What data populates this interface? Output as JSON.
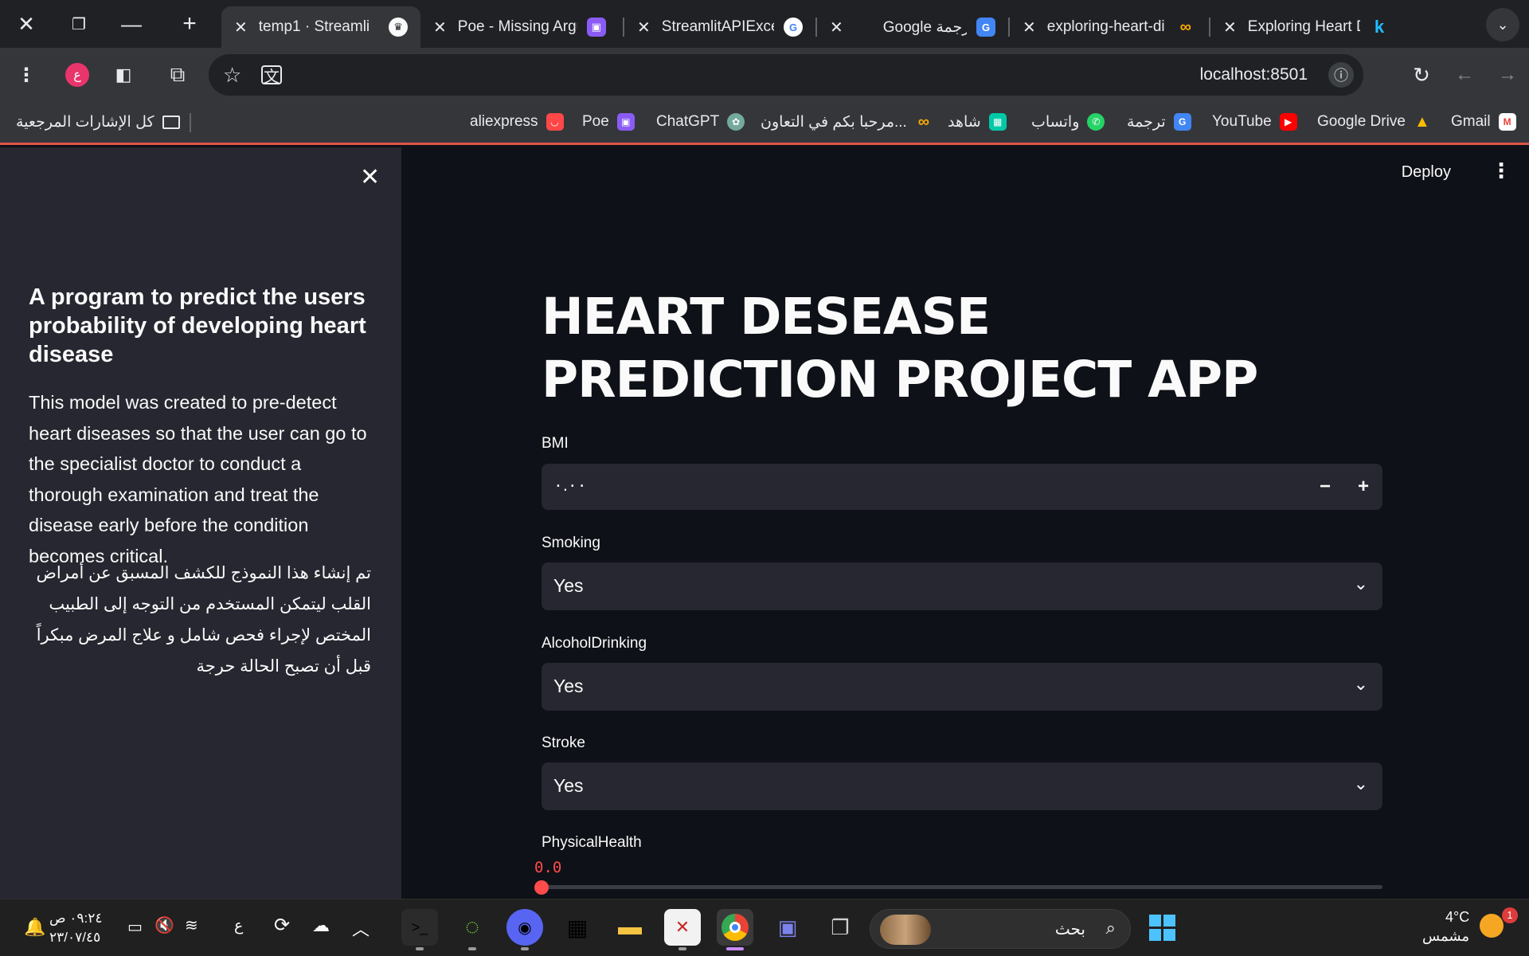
{
  "browser": {
    "tabs": [
      {
        "title": "temp1 · Streamlit",
        "active": true,
        "favicon": "streamlit-crown-icon"
      },
      {
        "title": "Poe - Missing Argu",
        "active": false,
        "favicon": "poe-icon"
      },
      {
        "title": "StreamlitAPIExcept",
        "active": false,
        "favicon": "google-icon"
      },
      {
        "title": "Google ترجمة",
        "active": false,
        "favicon": "google-translate-icon"
      },
      {
        "title": "exploring-heart-di",
        "active": false,
        "favicon": "colab-icon"
      },
      {
        "title": "Exploring Heart Dis",
        "active": false,
        "favicon": "kaggle-icon"
      }
    ],
    "profile_initial": "ع",
    "url": "localhost:8501",
    "bookmarks": [
      {
        "label": "Gmail",
        "icon": "gmail-icon",
        "color": "#ea4335"
      },
      {
        "label": "Google Drive",
        "icon": "google-drive-icon",
        "color": "#1fa463"
      },
      {
        "label": "YouTube",
        "icon": "youtube-icon",
        "color": "#ff0000"
      },
      {
        "label": "ترجمة",
        "icon": "google-translate-icon",
        "color": "#4285f4"
      },
      {
        "label": "واتساب",
        "icon": "whatsapp-icon",
        "color": "#25d366"
      },
      {
        "label": "شاهد",
        "icon": "shahid-icon",
        "color": "#00c9a7"
      },
      {
        "label": "مرحبا بكم في التعاون...",
        "icon": "colab-icon",
        "color": "#f9ab00"
      },
      {
        "label": "ChatGPT",
        "icon": "chatgpt-icon",
        "color": "#74aa9c"
      },
      {
        "label": "Poe",
        "icon": "poe-icon",
        "color": "#8a5cf5"
      },
      {
        "label": "aliexpress",
        "icon": "aliexpress-icon",
        "color": "#ff4747"
      }
    ],
    "all_bookmarks_label": "كل الإشارات المرجعية"
  },
  "app": {
    "deploy_label": "Deploy",
    "sidebar": {
      "title": "A program to predict the users probability of developing heart disease",
      "description": "This model was created to pre-detect heart diseases so that the user can go to the specialist doctor to conduct a thorough examination and treat the disease early before the condition becomes critical.",
      "description_ar": "تم إنشاء هذا النموذج للكشف المسبق عن أمراض القلب ليتمكن المستخدم من التوجه إلى الطبيب المختص لإجراء فحص شامل و علاج المرض مبكراً قبل أن تصبح الحالة حرجة"
    },
    "title": "HEART DESEASE PREDICTION PROJECT APP",
    "fields": {
      "bmi": {
        "label": "BMI",
        "value": "٠.٠٠"
      },
      "smoking": {
        "label": "Smoking",
        "value": "Yes"
      },
      "alcohol": {
        "label": "AlcoholDrinking",
        "value": "Yes"
      },
      "stroke": {
        "label": "Stroke",
        "value": "Yes"
      },
      "physical_health": {
        "label": "PhysicalHealth",
        "value_text": "0.0",
        "value": 0
      }
    },
    "accent_color": "#ff4b4b"
  },
  "taskbar": {
    "time": "٠٩:٢٤ ص",
    "date": "٢٣/٠٧/٤٥",
    "language": "ع",
    "search_label": "بحث",
    "weather_temp": "4°C",
    "weather_desc": "مشمس",
    "notification_count": "1"
  }
}
